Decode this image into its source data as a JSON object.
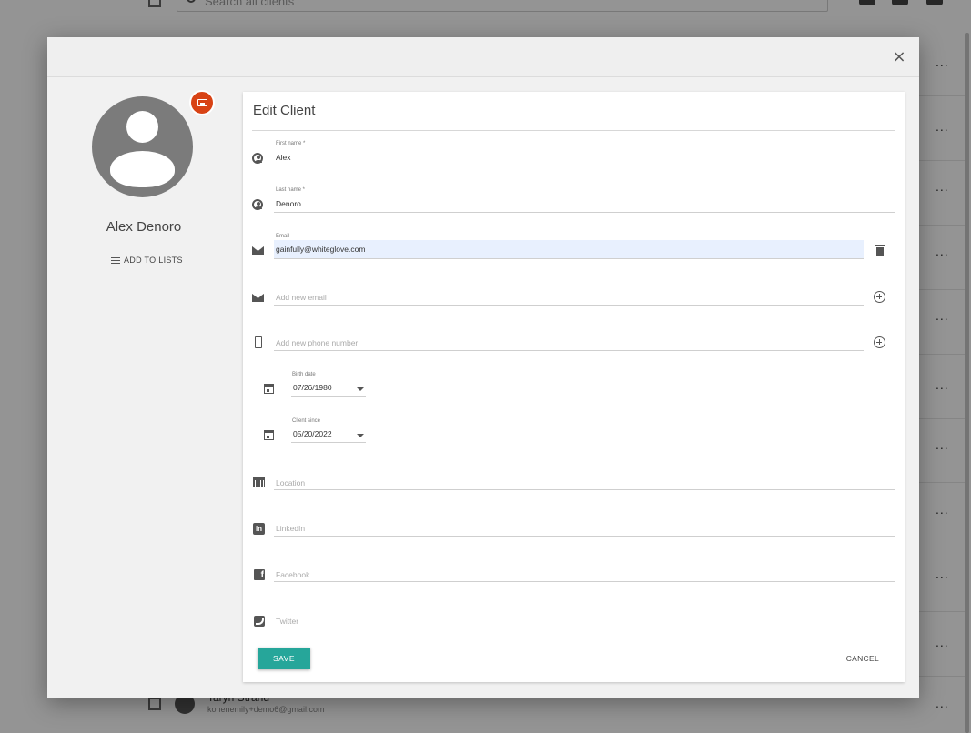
{
  "background": {
    "search_placeholder": "Search all clients",
    "row_more": "...",
    "visible_row": {
      "name": "Taryn Strand",
      "email": "konenemily+demo6@gmail.com"
    }
  },
  "modal": {
    "close_label": "×",
    "client_name": "Alex Denoro",
    "add_to_lists_label": "ADD TO LISTS",
    "title": "Edit Client",
    "fields": {
      "first_name": {
        "label": "First name *",
        "value": "Alex"
      },
      "last_name": {
        "label": "Last name *",
        "value": "Denoro"
      },
      "email": {
        "label": "Email",
        "value": "gainfully@whiteglove.com"
      },
      "new_email": {
        "placeholder": "Add new email"
      },
      "new_phone": {
        "placeholder": "Add new phone number"
      },
      "birth_date": {
        "label": "Birth date",
        "value": "07/26/1980"
      },
      "client_since": {
        "label": "Client since",
        "value": "05/20/2022"
      },
      "location": {
        "placeholder": "Location"
      },
      "linkedin": {
        "placeholder": "LinkedIn"
      },
      "facebook": {
        "placeholder": "Facebook"
      },
      "twitter": {
        "placeholder": "Twitter"
      }
    },
    "save_label": "SAVE",
    "cancel_label": "CANCEL"
  },
  "colors": {
    "accent": "#26a69a",
    "badge": "#d84315",
    "highlight": "#e8f0fe"
  }
}
